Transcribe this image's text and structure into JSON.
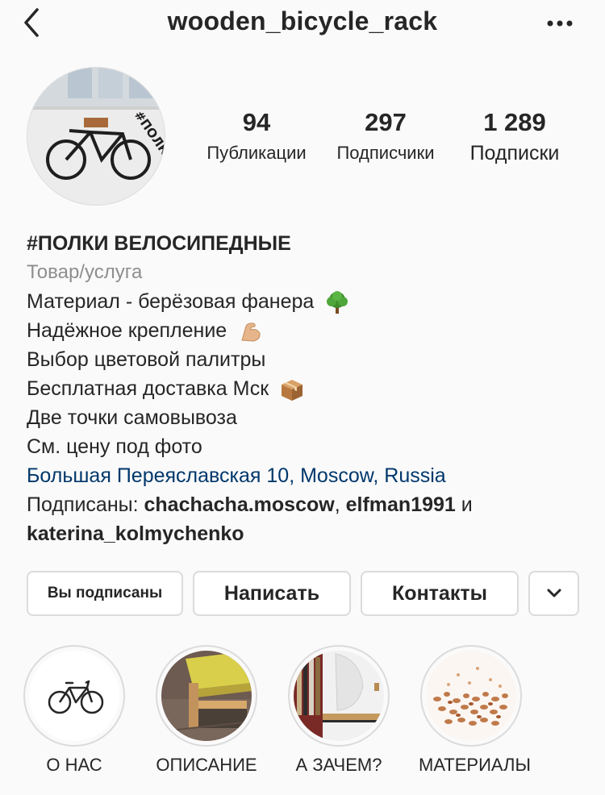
{
  "header": {
    "username": "wooden_bicycle_rack",
    "back_icon": "chevron-left-icon",
    "more_icon": "more-horizontal-icon"
  },
  "profile": {
    "avatar_icon": "bicycle-on-shelf-photo",
    "avatar_sign": "#ПОЛКИ",
    "stats": [
      {
        "value": "94",
        "label": "Публикации"
      },
      {
        "value": "297",
        "label": "Подписчики"
      },
      {
        "value": "1 289",
        "label": "Подписки"
      }
    ]
  },
  "bio": {
    "name": "#ПОЛКИ ВЕЛОСИПЕДНЫЕ",
    "category": "Товар/услуга",
    "lines": [
      "Материал - берёзовая фанера",
      "Надёжное крепление",
      "Выбор цветовой палитры",
      "Бесплатная доставка Мск",
      "Две точки самовывоза",
      "См. цену под фото"
    ],
    "line_emojis": [
      "tree-emoji",
      "flexed-biceps-emoji",
      "",
      "package-emoji",
      "",
      ""
    ],
    "location": "Большая Переяславская 10, Moscow, Russia",
    "followed_by_prefix": "Подписаны: ",
    "followed_by_1": "chachacha.moscow",
    "followed_by_sep1": ", ",
    "followed_by_2": "elfman1991",
    "followed_by_sep2": " и",
    "followed_by_3": "katerina_kolmychenko"
  },
  "actions": {
    "following": "Вы подписаны",
    "message": "Написать",
    "contacts": "Контакты",
    "suggest_icon": "chevron-down-icon"
  },
  "highlights": [
    {
      "label": "О НАС",
      "icon": "bicycle-icon"
    },
    {
      "label": "ОПИСАНИЕ",
      "icon": "shelf-photo"
    },
    {
      "label": "А ЗАЧЕМ?",
      "icon": "shelf-photo"
    },
    {
      "label": "МАТЕРИАЛЫ",
      "icon": "wood-chips-photo"
    }
  ],
  "colors": {
    "link": "#00376b",
    "secondary": "#8e8e8e",
    "border": "#dbdbdb",
    "text": "#262626"
  }
}
